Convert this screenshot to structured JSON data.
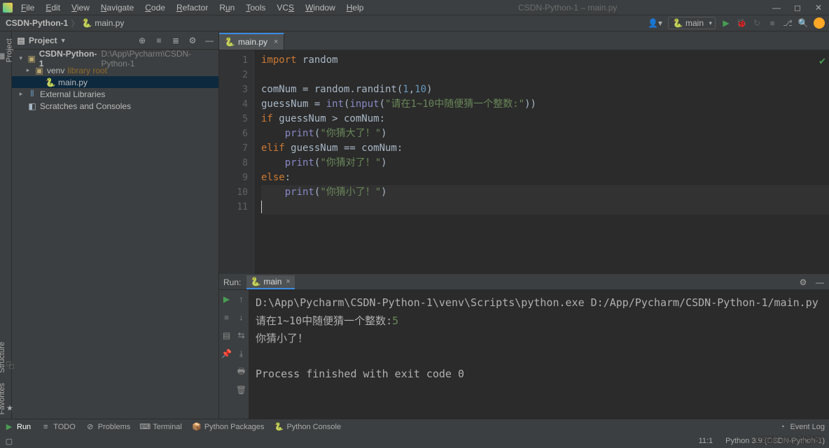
{
  "window": {
    "title": "CSDN-Python-1 – main.py"
  },
  "menu": {
    "file": "File",
    "edit": "Edit",
    "view": "View",
    "navigate": "Navigate",
    "code": "Code",
    "refactor": "Refactor",
    "run": "Run",
    "tools": "Tools",
    "vcs": "VCS",
    "window": "Window",
    "help": "Help"
  },
  "breadcrumb": {
    "project": "CSDN-Python-1",
    "file": "main.py"
  },
  "run_config": {
    "name": "main"
  },
  "side_tabs": {
    "project": "Project",
    "structure": "Structure",
    "favorites": "Favorites"
  },
  "project_panel": {
    "title": "Project",
    "root": {
      "name": "CSDN-Python-1",
      "path": "D:\\App\\Pycharm\\CSDN-Python-1"
    },
    "venv": {
      "name": "venv",
      "desc": "library root"
    },
    "main_file": "main.py",
    "ext_libs": "External Libraries",
    "scratches": "Scratches and Consoles"
  },
  "editor": {
    "tab_name": "main.py",
    "gutter": [
      "1",
      "2",
      "3",
      "4",
      "5",
      "6",
      "7",
      "8",
      "9",
      "10",
      "11"
    ],
    "code": {
      "l1_import": "import",
      "l1_random": "random",
      "l3_raw": "comNum = random.randint(",
      "l3_n1": "1",
      "l3_comma": ",",
      "l3_n2": "10",
      "l3_end": ")",
      "l4_a": "guessNum = ",
      "l4_int": "int",
      "l4_paren": "(",
      "l4_input": "input",
      "l4_paren2": "(",
      "l4_str": "\"请在1~10中随便猜一个整数:\"",
      "l4_end": "))",
      "l5_if": "if",
      "l5_cond": " guessNum > comNum:",
      "l6_print": "print",
      "l6_paren": "(",
      "l6_str": "\"你猜大了！\"",
      "l6_end": ")",
      "l7_elif": "elif",
      "l7_cond": " guessNum == comNum:",
      "l8_print": "print",
      "l8_paren": "(",
      "l8_str": "\"你猜对了！\"",
      "l8_end": ")",
      "l9_else": "else",
      "l9_colon": ":",
      "l10_print": "print",
      "l10_paren": "(",
      "l10_str": "\"你猜小了！\"",
      "l10_end": ")"
    }
  },
  "run_panel": {
    "label": "Run:",
    "tab": "main",
    "console_path": "D:\\App\\Pycharm\\CSDN-Python-1\\venv\\Scripts\\python.exe D:/App/Pycharm/CSDN-Python-1/main.py",
    "prompt": "请在1~10中随便猜一个整数:",
    "user_input": "5",
    "result": "你猜小了！",
    "exit_msg": "Process finished with exit code 0"
  },
  "bottom_tabs": {
    "run": "Run",
    "todo": "TODO",
    "problems": "Problems",
    "terminal": "Terminal",
    "py_packages": "Python Packages",
    "py_console": "Python Console",
    "event_log": "Event Log"
  },
  "status": {
    "cursor": "11:1",
    "python": "Python 3.9 (CSDN-Python-1)"
  },
  "watermark": "CSDN @小沐沐吖"
}
